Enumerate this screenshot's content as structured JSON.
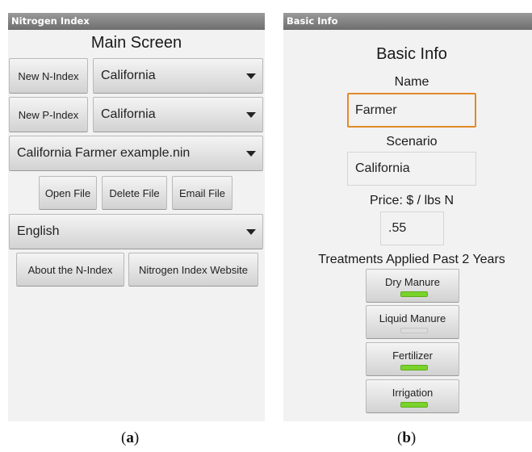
{
  "screen_a": {
    "titlebar": "Nitrogen Index",
    "heading": "Main Screen",
    "new_n_index_button": "New N-Index",
    "n_state_select": "California",
    "new_p_index_button": "New P-Index",
    "p_state_select": "California",
    "file_select": "California Farmer example.nin",
    "open_file_button": "Open File",
    "delete_file_button": "Delete File",
    "email_file_button": "Email File",
    "language_select": "English",
    "about_button": "About the N-Index",
    "website_button": "Nitrogen Index Website"
  },
  "screen_b": {
    "titlebar": "Basic Info",
    "heading": "Basic Info",
    "name_label": "Name",
    "name_value": "Farmer",
    "scenario_label": "Scenario",
    "scenario_value": "California",
    "price_label": "Price: $ / lbs N",
    "price_value": ".55",
    "treatments_label": "Treatments Applied Past 2 Years",
    "toggles": [
      {
        "label": "Dry Manure",
        "on": true
      },
      {
        "label": "Liquid Manure",
        "on": false
      },
      {
        "label": "Fertilizer",
        "on": true
      },
      {
        "label": "Irrigation",
        "on": true
      }
    ]
  },
  "captions": {
    "a_open": "(",
    "a_letter": "a",
    "a_close": ")",
    "b_open": "(",
    "b_letter": "b",
    "b_close": ")"
  },
  "colors": {
    "focus_border": "#e28a2a",
    "toggle_on": "#7ad32b",
    "toggle_off": "#dcdcdc"
  }
}
